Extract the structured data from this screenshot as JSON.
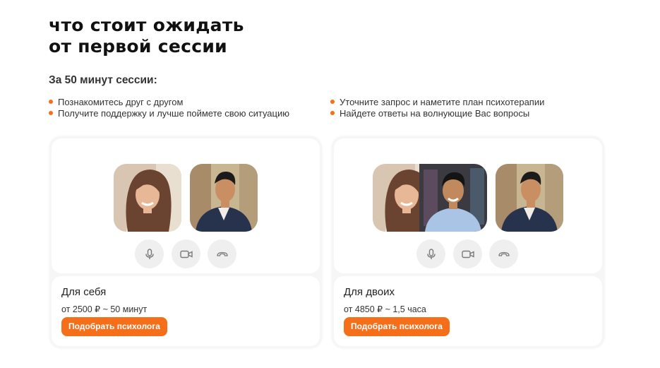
{
  "header": {
    "title_line1": "что стоит ожидать",
    "title_line2": "от первой сессии",
    "subtitle": "За 50 минут сессии:"
  },
  "bullets_left": [
    "Познакомитесь друг с другом",
    "Получите поддержку и лучше поймете свою ситуацию"
  ],
  "bullets_right": [
    "Уточните запрос и наметите план психотерапии",
    "Найдете ответы на волнующие Вас вопросы"
  ],
  "cards": [
    {
      "name": "Для себя",
      "price": "от 2500 ₽ ~ 50 минут",
      "button": "Подобрать психолога",
      "participants": [
        "woman-avatar",
        "man-avatar"
      ]
    },
    {
      "name": "Для двоих",
      "price": "от 4850 ₽ ~ 1,5 часа",
      "button": "Подобрать психолога",
      "participants": [
        "woman-avatar",
        "young-man-avatar",
        "man-avatar"
      ]
    }
  ],
  "controls": [
    "microphone-icon",
    "camera-icon",
    "hang-up-icon"
  ],
  "colors": {
    "accent": "#f56e1a",
    "card_bg": "#f6f6f6",
    "control_bg": "#efefef"
  }
}
